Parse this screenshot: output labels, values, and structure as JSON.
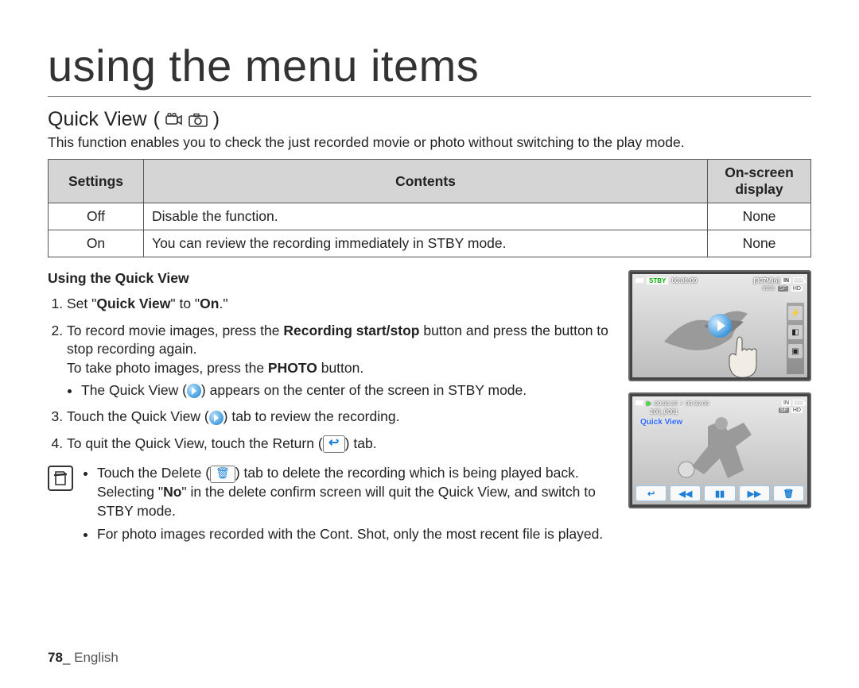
{
  "chapter_title": "using the menu items",
  "section": {
    "title": "Quick View",
    "mode_icons": [
      "video-mode-icon",
      "photo-mode-icon"
    ]
  },
  "intro": "This function enables you to check the just recorded movie or photo without switching to the play mode.",
  "table": {
    "headers": {
      "settings": "Settings",
      "contents": "Contents",
      "osd": "On-screen display"
    },
    "rows": [
      {
        "setting": "Off",
        "content": "Disable the function.",
        "osd": "None"
      },
      {
        "setting": "On",
        "content": "You can review the recording immediately in STBY mode.",
        "osd": "None"
      }
    ]
  },
  "usage": {
    "heading": "Using the Quick View",
    "step1_a": "Set \"",
    "step1_b": "Quick View",
    "step1_c": "\" to \"",
    "step1_d": "On",
    "step1_e": ".\"",
    "step2_a": "To record movie images, press the ",
    "step2_b": "Recording start/stop",
    "step2_c": " button and press the button to stop recording again.",
    "step2_line2_a": "To take photo images, press the ",
    "step2_line2_b": "PHOTO",
    "step2_line2_c": " button.",
    "step2_bullet_a": "The Quick View (",
    "step2_bullet_b": ") appears on the center of the screen in STBY mode.",
    "step3_a": "Touch the Quick View (",
    "step3_b": ") tab to review the recording.",
    "step4_a": "To quit the Quick View, touch the Return (",
    "step4_b": ") tab."
  },
  "notes": {
    "n1_a": "Touch the Delete (",
    "n1_b": ") tab to delete the recording which is being played back. Selecting \"",
    "n1_c": "No",
    "n1_d": "\" in the delete confirm screen will quit the Quick View, and switch to STBY mode.",
    "n2": "For photo images recorded with the Cont. Shot, only the most recent file is played."
  },
  "lcd1": {
    "stby": "STBY",
    "time": "00:00:00",
    "remain": "[307Min]",
    "card": "IN",
    "count": "9999",
    "sf": "SF",
    "hd": "HD"
  },
  "lcd2": {
    "time_elapsed": "00:00:20",
    "time_total": "00:30:00",
    "card": "IN",
    "folder": "100_0001",
    "sf": "SF",
    "hd": "HD",
    "label": "Quick View",
    "controls": [
      "↩",
      "◀◀",
      "▮▮",
      "▶▶",
      "🗑"
    ]
  },
  "footer": {
    "page": "78",
    "sep": "_ ",
    "lang": "English"
  }
}
